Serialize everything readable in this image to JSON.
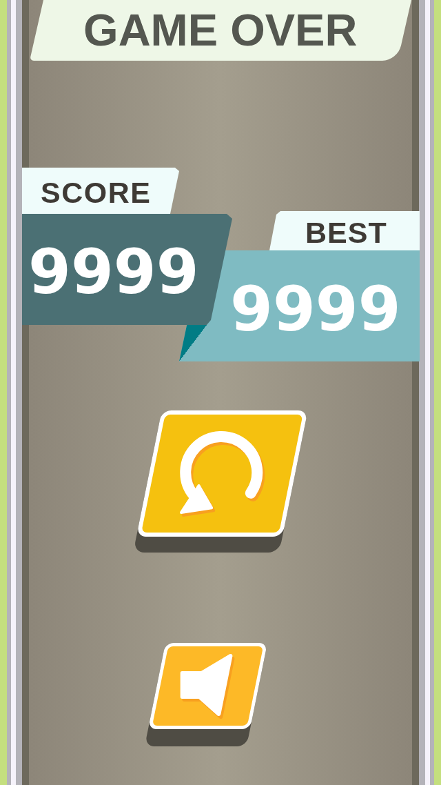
{
  "title": "GAME OVER",
  "score": {
    "label": "SCORE",
    "value": "9999"
  },
  "best": {
    "label": "BEST",
    "value": "9999"
  },
  "buttons": [
    {
      "kind": "restart"
    },
    {
      "kind": "sound"
    }
  ]
}
